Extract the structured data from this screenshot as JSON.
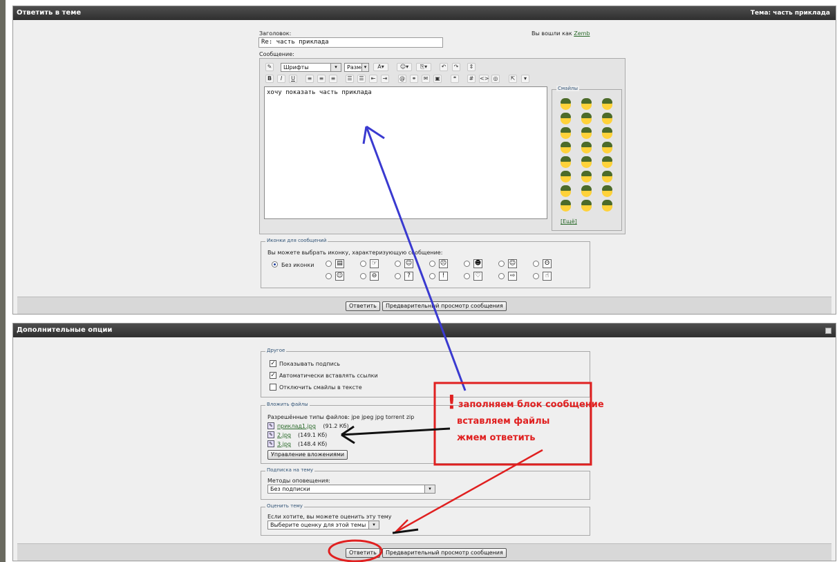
{
  "reply_panel": {
    "title": "Ответить в теме",
    "topic_label": "Тема:",
    "topic_name": "часть приклада",
    "subject_label": "Заголовок:",
    "subject_value": "Re: часть приклада",
    "logged_in_as": "Вы вошли как",
    "username": "Zemb",
    "message_label": "Сообщение:",
    "message_text": "хочу показать часть приклада",
    "font_select": "Шрифты",
    "size_select": "Разме",
    "toolbar_bold": "B",
    "toolbar_italic": "I",
    "toolbar_underline": "U",
    "toolbar_hash": "#",
    "toolbar_code": "<>",
    "smilies_legend": "Смайлы",
    "smilies_more": "[Ещё]",
    "icons_legend": "Иконки для сообщений",
    "icons_hint": "Вы можете выбрать иконку, характеризующую сообщение:",
    "no_icon_label": "Без иконки",
    "icon_glyphs_row1": [
      "▤",
      "☞",
      "☺",
      "☹",
      "☻",
      "☺",
      "ʘ"
    ],
    "icon_glyphs_row2": [
      "☺",
      "⊖",
      "?",
      "!",
      "♡",
      "⇨",
      "☝"
    ],
    "reply_button": "Ответить",
    "preview_button": "Предварительный просмотр сообщения"
  },
  "options_panel": {
    "title": "Дополнительные опции",
    "other_legend": "Другое",
    "options": [
      {
        "label": "Показывать подпись",
        "checked": true
      },
      {
        "label": "Автоматически вставлять ссылки",
        "checked": true
      },
      {
        "label": "Отключить смайлы в тексте",
        "checked": false
      }
    ],
    "attach_legend": "Вложить файлы",
    "allowed_types": "Разрешённые типы файлов: jpe jpeg jpg torrent zip",
    "files": [
      {
        "name": "приклад1.jpg",
        "size": "(91.2 Кб)"
      },
      {
        "name": "2.jpg",
        "size": "(149.1 Кб)"
      },
      {
        "name": "3.jpg",
        "size": "(148.4 Кб)"
      }
    ],
    "manage_attachments": "Управление вложениями",
    "subscribe_legend": "Подписка на тему",
    "notify_label": "Методы оповещения:",
    "notify_value": "Без подписки",
    "rate_legend": "Оценить тему",
    "rate_hint": "Если хотите, вы можете оценить эту тему",
    "rate_value": "Выберите оценку для этой темы",
    "reply_button": "Ответить",
    "preview_button": "Предварительный просмотр сообщения"
  },
  "annotation": {
    "exclamation": "!",
    "lines": [
      "заполняем блок сообщение",
      "вставляем файлы",
      "жмем ответить"
    ],
    "color_red": "#e02020",
    "color_blue": "#3a3ad0"
  }
}
